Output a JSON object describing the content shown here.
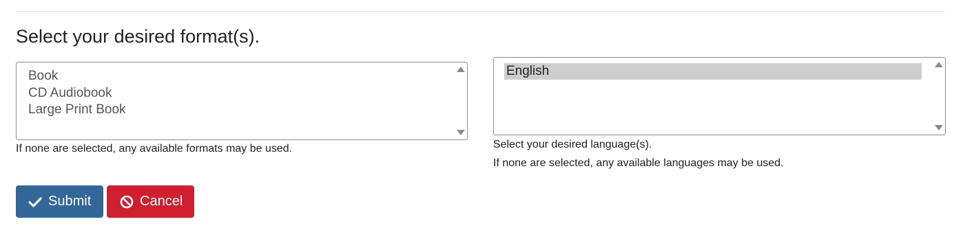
{
  "heading": "Select your desired format(s).",
  "formats": {
    "options": [
      "Book",
      "CD Audiobook",
      "Large Print Book"
    ],
    "help": "If none are selected, any available formats may be used."
  },
  "languages": {
    "options": [
      "English"
    ],
    "selected": "English",
    "label": "Select your desired language(s).",
    "help": "If none are selected, any available languages may be used."
  },
  "buttons": {
    "submit": {
      "label": "Submit",
      "icon": "check-icon",
      "color": "#336699"
    },
    "cancel": {
      "label": "Cancel",
      "icon": "ban-icon",
      "color": "#d02030"
    }
  }
}
